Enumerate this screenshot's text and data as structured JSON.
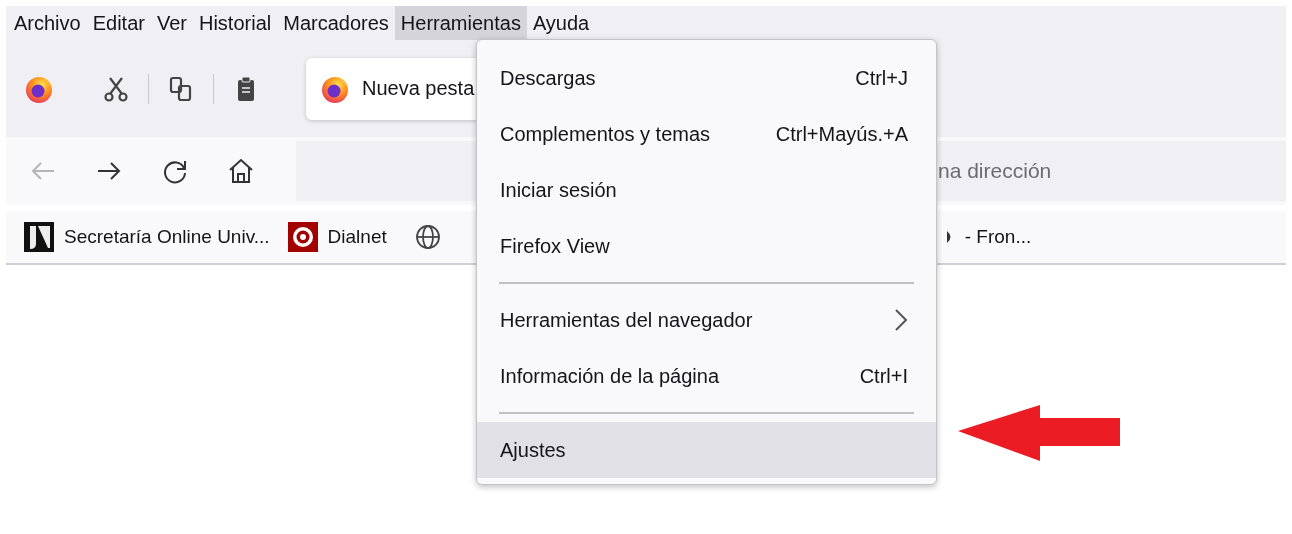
{
  "menu_bar": [
    {
      "label": "Archivo",
      "selected": false
    },
    {
      "label": "Editar",
      "selected": false
    },
    {
      "label": "Ver",
      "selected": false
    },
    {
      "label": "Historial",
      "selected": false
    },
    {
      "label": "Marcadores",
      "selected": false
    },
    {
      "label": "Herramientas",
      "selected": true
    },
    {
      "label": "Ayuda",
      "selected": false
    }
  ],
  "tab": {
    "title": "Nueva pesta"
  },
  "nav": {
    "back_disabled": true
  },
  "url_bar": {
    "placeholder": "na dirección"
  },
  "bookmarks": [
    {
      "kind": "jv",
      "label": "Secretaría Online Univ..."
    },
    {
      "kind": "dialnet",
      "label": "Dialnet"
    },
    {
      "kind": "globe"
    },
    {
      "kind": "page",
      "label": "- Fron..."
    }
  ],
  "tools_menu": [
    {
      "kind": "item",
      "label": "Descargas",
      "shortcut": "Ctrl+J",
      "submenu": false,
      "selected": false
    },
    {
      "kind": "item",
      "label": "Complementos y temas",
      "shortcut": "Ctrl+Mayús.+A",
      "submenu": false,
      "selected": false
    },
    {
      "kind": "item",
      "label": "Iniciar sesión",
      "submenu": false,
      "selected": false
    },
    {
      "kind": "item",
      "label": "Firefox View",
      "submenu": false,
      "selected": false
    },
    {
      "kind": "separator"
    },
    {
      "kind": "item",
      "label": "Herramientas del navegador",
      "submenu": true,
      "selected": false
    },
    {
      "kind": "item",
      "label": "Información de la página",
      "shortcut": "Ctrl+I",
      "submenu": false,
      "selected": false
    },
    {
      "kind": "separator"
    },
    {
      "kind": "item",
      "label": "Ajustes",
      "submenu": false,
      "selected": true
    }
  ]
}
